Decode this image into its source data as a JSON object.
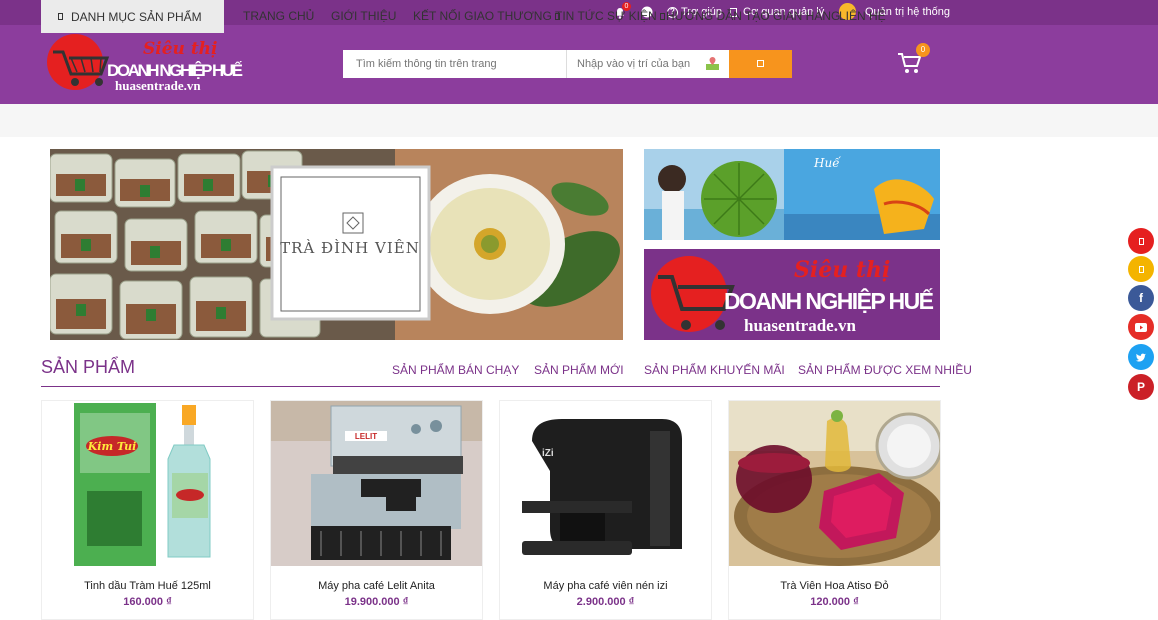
{
  "topbar": {
    "notification_count": "0",
    "help_label": "Trợ giúp",
    "agency_label": "Cơ quan quản lý",
    "admin_label": "Quản trị hệ thống"
  },
  "logo": {
    "script_text": "Siêu thị",
    "main_text": "DOANH NGHIỆP HUẾ",
    "domain_text": "huasentrade.vn"
  },
  "search": {
    "placeholder": "Tìm kiếm thông tin trên trang",
    "location_placeholder": "Nhập vào vị trí của bạn"
  },
  "cart": {
    "count": "0"
  },
  "nav": {
    "category_label": "DANH MỤC SẢN PHẨM",
    "items": [
      "TRANG CHỦ",
      "GIỚI THIỆU",
      "KẾT NỐI GIAO THƯƠNG",
      "TIN TỨC SỰ KIỆN",
      "HƯỚNG DẪN TẠO GIAN HÀNG",
      "LIÊN HỆ"
    ]
  },
  "banner": {
    "brand_text": "TRÀ ĐÌNH VIÊN",
    "hue_text": "Huế",
    "ad_script": "Siêu thị",
    "ad_main": "DOANH NGHIỆP HUẾ",
    "ad_domain": "huasentrade.vn"
  },
  "products_section": {
    "title": "SẢN PHẨM",
    "tabs": [
      "SẢN PHẨM BÁN CHẠY",
      "SẢN PHẨM MỚI",
      "SẢN PHẨM KHUYẾN MÃI",
      "SẢN PHẨM ĐƯỢC XEM NHIỀU"
    ]
  },
  "products": [
    {
      "name": "Tinh dầu Tràm Huế 125ml",
      "price": "160.000 ₫",
      "label": "Kim Tui"
    },
    {
      "name": "Máy pha café Lelit Anita",
      "price": "19.900.000 ₫",
      "label": "LELIT"
    },
    {
      "name": "Máy pha café viên nén izi",
      "price": "2.900.000 ₫",
      "label": "iZi"
    },
    {
      "name": "Trà Viên Hoa Atiso Đỏ",
      "price": "120.000 ₫",
      "label": ""
    }
  ],
  "social_icons": [
    "pin-icon",
    "bookmark-icon",
    "facebook-icon",
    "youtube-icon",
    "twitter-icon",
    "pinterest-icon"
  ],
  "colors": {
    "primary": "#8c3d9d",
    "topbar": "#7b3289",
    "accent": "#f7941d",
    "price": "#7b3289"
  }
}
